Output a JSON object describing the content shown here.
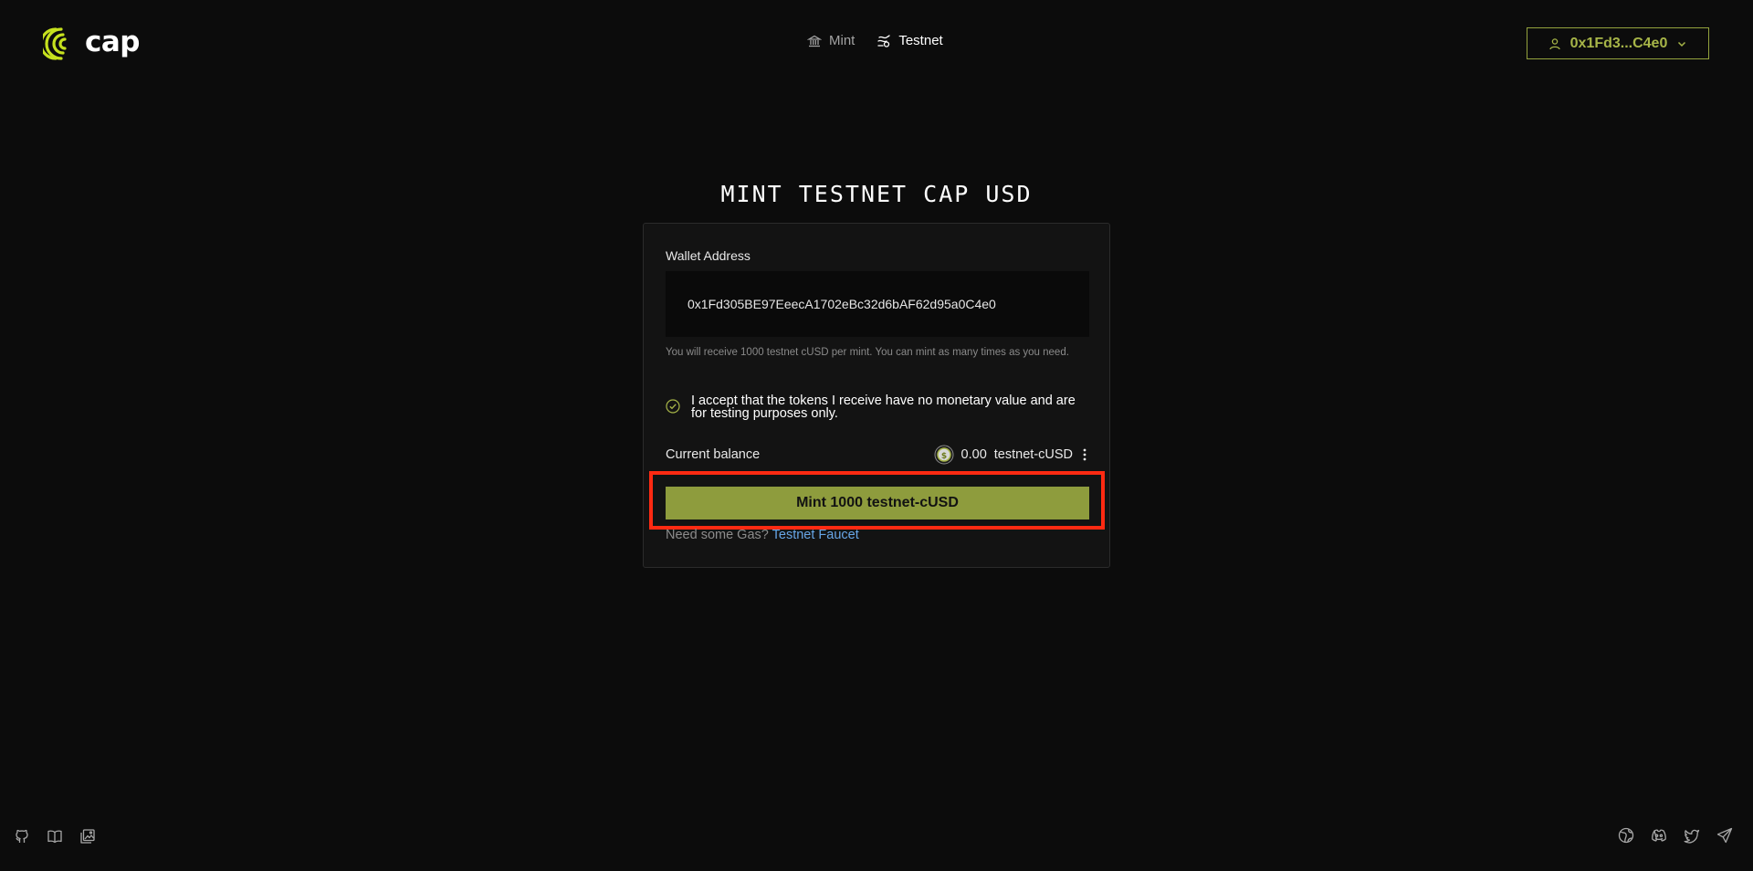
{
  "colors": {
    "background": "#0c0c0c",
    "card": "#131313",
    "accent": "#a7b548",
    "button": "#8e9c3d",
    "highlight": "#ff2a12",
    "link": "#67a6e6"
  },
  "header": {
    "logo_text": "cap",
    "logo_icon": "cap-logo-icon",
    "nav": [
      {
        "label": "Mint",
        "icon": "bank-icon",
        "active": false
      },
      {
        "label": "Testnet",
        "icon": "flask-icon",
        "active": true
      }
    ],
    "wallet_button": {
      "label": "0x1Fd3...C4e0",
      "icon": "user-icon",
      "chevron": "chevron-down-icon"
    }
  },
  "main": {
    "title": "MINT TESTNET CAP USD",
    "wallet_label": "Wallet Address",
    "wallet_value": "0x1Fd305BE97EeecA1702eBc32d6bAF62d95a0C4e0",
    "helper": "You will receive 1000 testnet cUSD per mint. You can mint as many times as you need.",
    "accept_text": "I accept that the tokens I receive have no monetary value and are for testing purposes only.",
    "accept_checked": true,
    "balance_label": "Current balance",
    "balance_value": "0.00",
    "balance_unit": "testnet-cUSD",
    "mint_button": "Mint 1000 testnet-cUSD",
    "gas_prompt": "Need some Gas?",
    "gas_link": "Testnet Faucet"
  },
  "footer": {
    "left_icons": [
      "github-icon",
      "book-icon",
      "image-gallery-icon"
    ],
    "right_icons": [
      "globe-icon",
      "discord-icon",
      "twitter-icon",
      "telegram-icon"
    ]
  }
}
